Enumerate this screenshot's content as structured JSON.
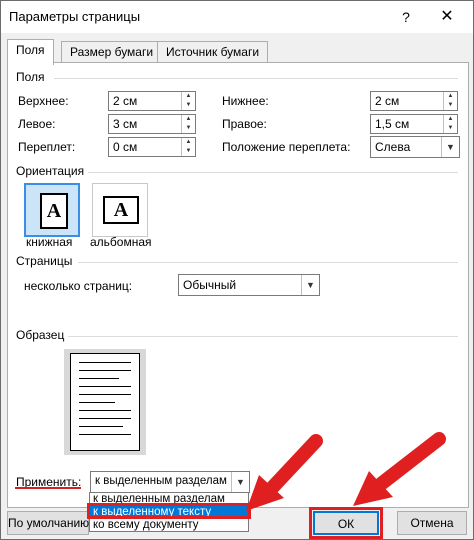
{
  "window": {
    "title": "Параметры страницы",
    "help": "?",
    "close": "✕"
  },
  "tabs": [
    "Поля",
    "Размер бумаги",
    "Источник бумаги"
  ],
  "margins": {
    "group": "Поля",
    "top_label": "Верхнее:",
    "top_value": "2 см",
    "bottom_label": "Нижнее:",
    "bottom_value": "2 см",
    "left_label": "Левое:",
    "left_value": "3 см",
    "right_label": "Правое:",
    "right_value": "1,5 см",
    "gutter_label": "Переплет:",
    "gutter_value": "0 см",
    "gutter_pos_label": "Положение переплета:",
    "gutter_pos_value": "Слева"
  },
  "orientation": {
    "group": "Ориентация",
    "portrait_label": "книжная",
    "landscape_label": "альбомная",
    "glyph": "A"
  },
  "pages": {
    "group": "Страницы",
    "multiple_label": "несколько страниц:",
    "multiple_value": "Обычный"
  },
  "preview": {
    "group": "Образец"
  },
  "apply": {
    "label": "Применить:",
    "value": "к выделенным разделам",
    "options": [
      "к выделенным разделам",
      "к выделенному тексту",
      "ко всему документу"
    ],
    "selected_option": "к выделенному тексту"
  },
  "buttons": {
    "default": "По умолчанию",
    "ok": "ОК",
    "cancel": "Отмена"
  },
  "colors": {
    "annotation_red": "#e02020",
    "selection_blue": "#0078d7"
  }
}
